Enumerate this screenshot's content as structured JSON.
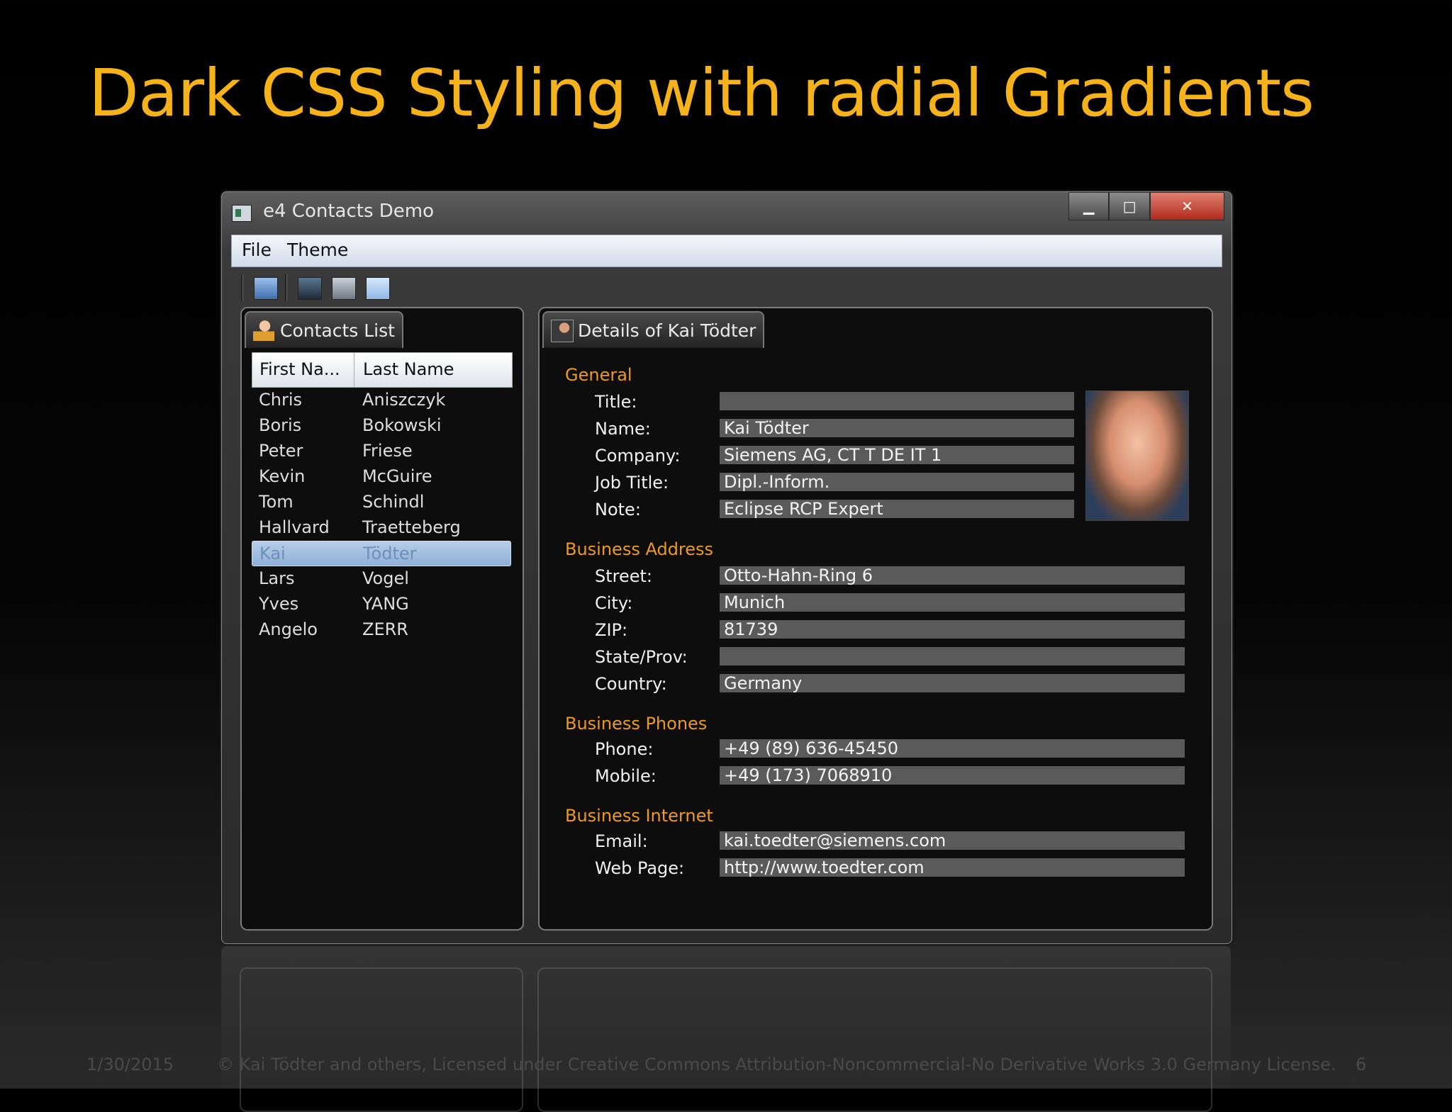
{
  "slide": {
    "title": "Dark CSS Styling with radial Gradients",
    "footer_date": "1/30/2015",
    "footer_license": "© Kai Tödter and others, Licensed under Creative Commons Attribution-Noncommercial-No Derivative Works 3.0 Germany License.",
    "page_number": "6"
  },
  "window": {
    "title": "e4 Contacts Demo",
    "minimize_label": "▁",
    "maximize_label": "□",
    "close_label": "✕"
  },
  "menu": [
    "File",
    "Theme"
  ],
  "contacts": {
    "tab_label": "Contacts List",
    "columns": [
      "First Na...",
      "Last Name"
    ],
    "rows": [
      [
        "Chris",
        "Aniszczyk"
      ],
      [
        "Boris",
        "Bokowski"
      ],
      [
        "Peter",
        "Friese"
      ],
      [
        "Kevin",
        "McGuire"
      ],
      [
        "Tom",
        "Schindl"
      ],
      [
        "Hallvard",
        "Traetteberg"
      ],
      [
        "Kai",
        "Tödter"
      ],
      [
        "Lars",
        "Vogel"
      ],
      [
        "Yves",
        "YANG"
      ],
      [
        "Angelo",
        "ZERR"
      ]
    ],
    "selected_index": 6
  },
  "details": {
    "tab_label": "Details of Kai Tödter",
    "sections": {
      "general": "General",
      "address": "Business Address",
      "phones": "Business Phones",
      "internet": "Business Internet"
    },
    "fields": {
      "title": {
        "label": "Title:",
        "value": ""
      },
      "name": {
        "label": "Name:",
        "value": "Kai Tödter"
      },
      "company": {
        "label": "Company:",
        "value": "Siemens AG, CT T DE IT 1"
      },
      "job_title": {
        "label": "Job Title:",
        "value": "Dipl.-Inform."
      },
      "note": {
        "label": "Note:",
        "value": "Eclipse RCP Expert"
      },
      "street": {
        "label": "Street:",
        "value": "Otto-Hahn-Ring 6"
      },
      "city": {
        "label": "City:",
        "value": "Munich"
      },
      "zip": {
        "label": "ZIP:",
        "value": "81739"
      },
      "state": {
        "label": "State/Prov:",
        "value": ""
      },
      "country": {
        "label": "Country:",
        "value": "Germany"
      },
      "phone": {
        "label": "Phone:",
        "value": "+49 (89) 636-45450"
      },
      "mobile": {
        "label": "Mobile:",
        "value": "+49 (173) 7068910"
      },
      "email": {
        "label": "Email:",
        "value": "kai.toedter@siemens.com"
      },
      "web_page": {
        "label": "Web Page:",
        "value": "http://www.toedter.com"
      }
    }
  },
  "colors": {
    "title_orange": "#f5b21a",
    "section_orange": "#f09a1c",
    "field_gray": "#5a5a5a",
    "selection_blue": "#8eb0d6"
  }
}
